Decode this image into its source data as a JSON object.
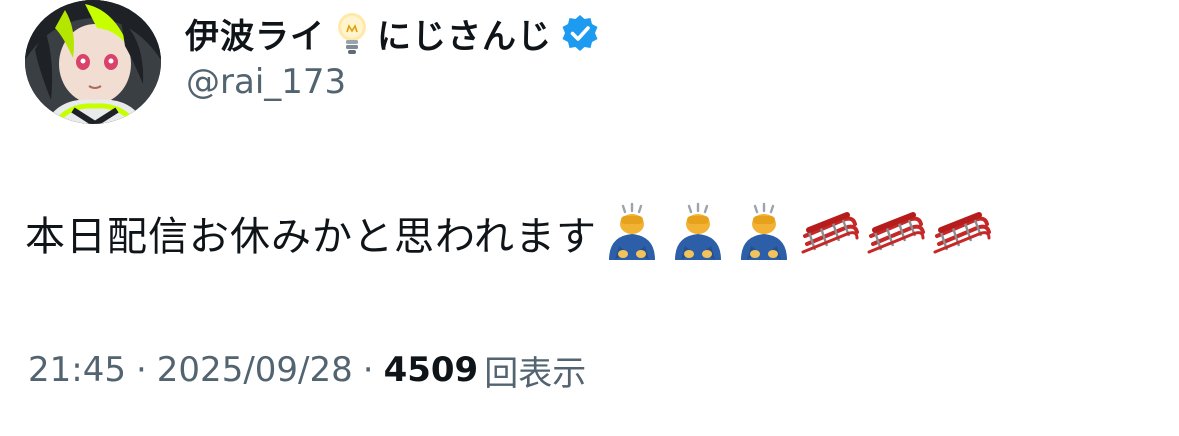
{
  "user": {
    "display_name": "伊波ライ",
    "display_name_suffix": "にじさんじ",
    "name_emoji_icon": "lightbulb-icon",
    "verified_icon": "verified-badge-icon",
    "handle": "@rai_173",
    "avatar": "avatar"
  },
  "tweet": {
    "text": "本日配信お休みかと思われます",
    "emojis": [
      "person-bowing-icon",
      "person-bowing-icon",
      "person-bowing-icon",
      "sled-icon",
      "sled-icon",
      "sled-icon"
    ]
  },
  "meta": {
    "time": "21:45",
    "separator": "·",
    "date": "2025/09/28",
    "views_count": "4509",
    "views_label": "回表示"
  },
  "colors": {
    "text_primary": "#0f1419",
    "text_secondary": "#536471",
    "verified_blue": "#1d9bf0",
    "accent_lime": "#c8ff00"
  }
}
